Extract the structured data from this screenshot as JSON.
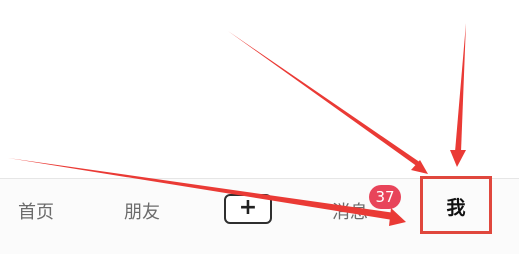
{
  "tabbar": {
    "home_label": "首页",
    "friends_label": "朋友",
    "create_glyph": "+",
    "messages_label": "消息",
    "messages_badge": "37",
    "me_label": "我"
  },
  "annotations": {
    "arrow_color": "#ea3a35",
    "highlight_color": "#e0473d"
  },
  "colors": {
    "badge": "#e8445a",
    "tab_text": "#6b6b6b",
    "active_tab_text": "#111111"
  }
}
